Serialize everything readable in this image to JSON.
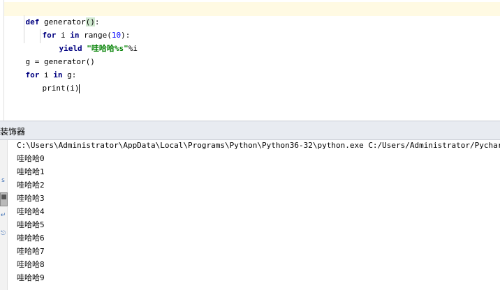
{
  "editor": {
    "lines": [
      {
        "kw": "def",
        "rest": "generator",
        "paren": "()",
        "colon": ":"
      },
      {
        "kw1": "for",
        "mid1": "i",
        "kw2": "in",
        "fn": "range(",
        "num": "10",
        "close": "):"
      },
      {
        "kw": "yield",
        "str": "\"哇哈哈%s\"",
        "rest": "%i"
      },
      {
        "text": "g = generator()"
      },
      {
        "kw1": "for",
        "mid": "i",
        "kw2": "in",
        "rest": "g:"
      },
      {
        "text": "print(i)"
      }
    ]
  },
  "run_panel": {
    "title": "装饰器",
    "tools": [
      "s",
      "↻",
      "■",
      "↵",
      "⎋"
    ]
  },
  "console": {
    "command": "C:\\Users\\Administrator\\AppData\\Local\\Programs\\Python\\Python36-32\\python.exe C:/Users/Administrator/PycharmProjects/d",
    "output": [
      "哇哈哈0",
      "哇哈哈1",
      "哇哈哈2",
      "哇哈哈3",
      "哇哈哈4",
      "哇哈哈5",
      "哇哈哈6",
      "哇哈哈7",
      "哇哈哈8",
      "哇哈哈9"
    ]
  }
}
